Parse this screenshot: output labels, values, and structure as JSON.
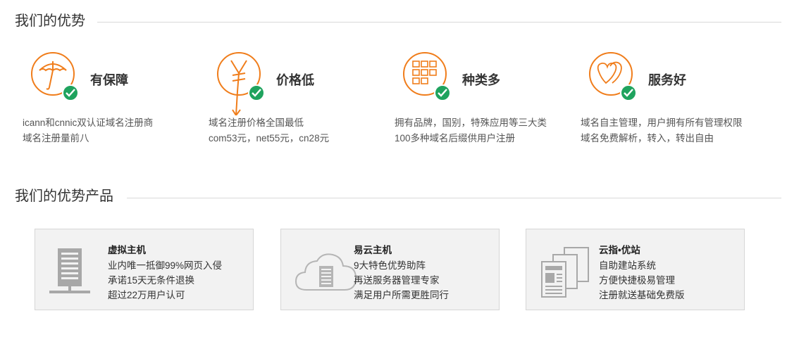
{
  "sections": {
    "advantages_title": "我们的优势",
    "products_title": "我们的优势产品"
  },
  "advantages": [
    {
      "title": "有保障",
      "icon": "umbrella-icon",
      "lines": [
        "icann和cnnic双认证域名注册商",
        "域名注册量前八"
      ]
    },
    {
      "title": "价格低",
      "icon": "yen-icon",
      "lines": [
        "域名注册价格全国最低",
        "com53元，net55元，cn28元"
      ]
    },
    {
      "title": "种类多",
      "icon": "grid-icon",
      "lines": [
        "拥有品牌，国别，特殊应用等三大类",
        "100多种域名后缀供用户注册"
      ]
    },
    {
      "title": "服务好",
      "icon": "hearts-icon",
      "lines": [
        "域名自主管理，用户拥有所有管理权限",
        "域名免费解析，转入，转出自由"
      ]
    }
  ],
  "products": [
    {
      "title": "虚拟主机",
      "icon": "server-icon",
      "lines": [
        "业内唯一抵御99%网页入侵",
        "承诺15天无条件退换",
        "超过22万用户认可"
      ]
    },
    {
      "title": "易云主机",
      "icon": "cloud-server-icon",
      "lines": [
        "9大特色优势助阵",
        "再送服务器管理专家",
        "满足用户所需更胜同行"
      ]
    },
    {
      "title": "云指•优站",
      "icon": "pages-icon",
      "lines": [
        "自助建站系统",
        "方便快捷极易管理",
        "注册就送基础免费版"
      ]
    }
  ],
  "colors": {
    "accent": "#f07d1b",
    "check": "#1fa35e",
    "card_bg": "#f2f2f2",
    "icon_gray": "#a8a8a8"
  }
}
